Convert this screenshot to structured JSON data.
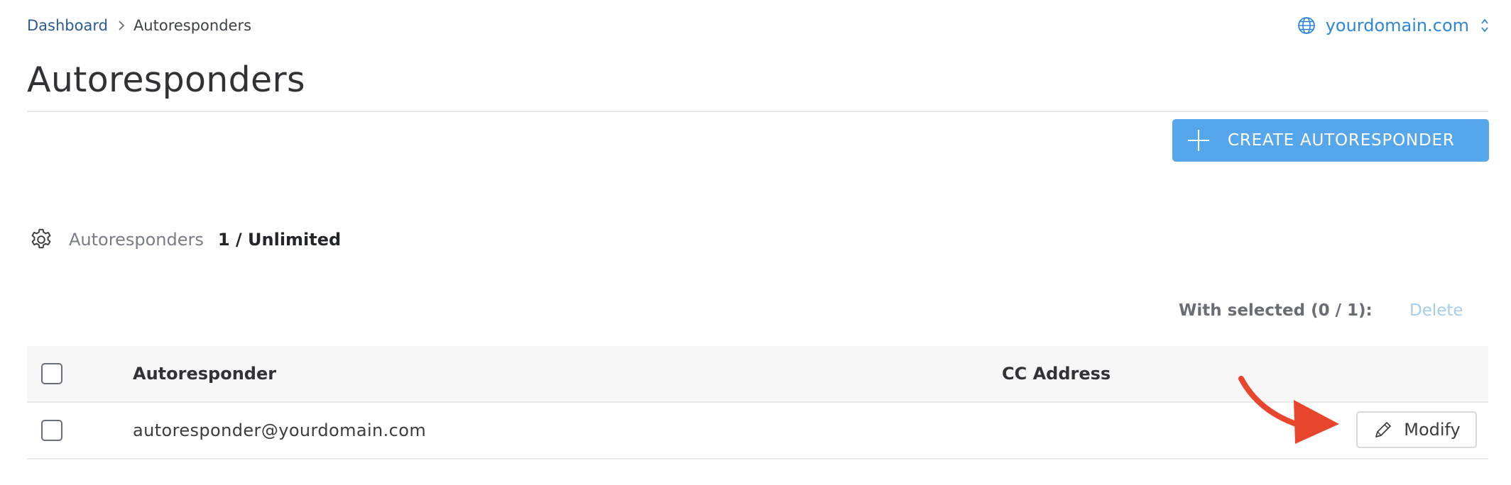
{
  "breadcrumb": {
    "items": [
      "Dashboard",
      "Autoresponders"
    ]
  },
  "domain_switcher": {
    "label": "yourdomain.com"
  },
  "page": {
    "title": "Autoresponders"
  },
  "actions": {
    "create_label": "CREATE AUTORESPONDER"
  },
  "quota": {
    "label": "Autoresponders",
    "value": "1 / Unlimited"
  },
  "bulk": {
    "with_selected": "With selected (0 / 1):",
    "delete_label": "Delete"
  },
  "table": {
    "columns": [
      "Autoresponder",
      "CC Address"
    ],
    "rows": [
      {
        "autoresponder": "autoresponder@yourdomain.com",
        "cc_address": "",
        "action_label": "Modify"
      }
    ]
  },
  "colors": {
    "accent": "#56a6ec",
    "link": "#2d87d9",
    "annotation_arrow": "#e8452d"
  },
  "icons": [
    "chevron-right-icon",
    "globe-icon",
    "updown-chevron-icon",
    "plus-icon",
    "gear-icon",
    "pencil-icon",
    "arrow-annotation"
  ]
}
